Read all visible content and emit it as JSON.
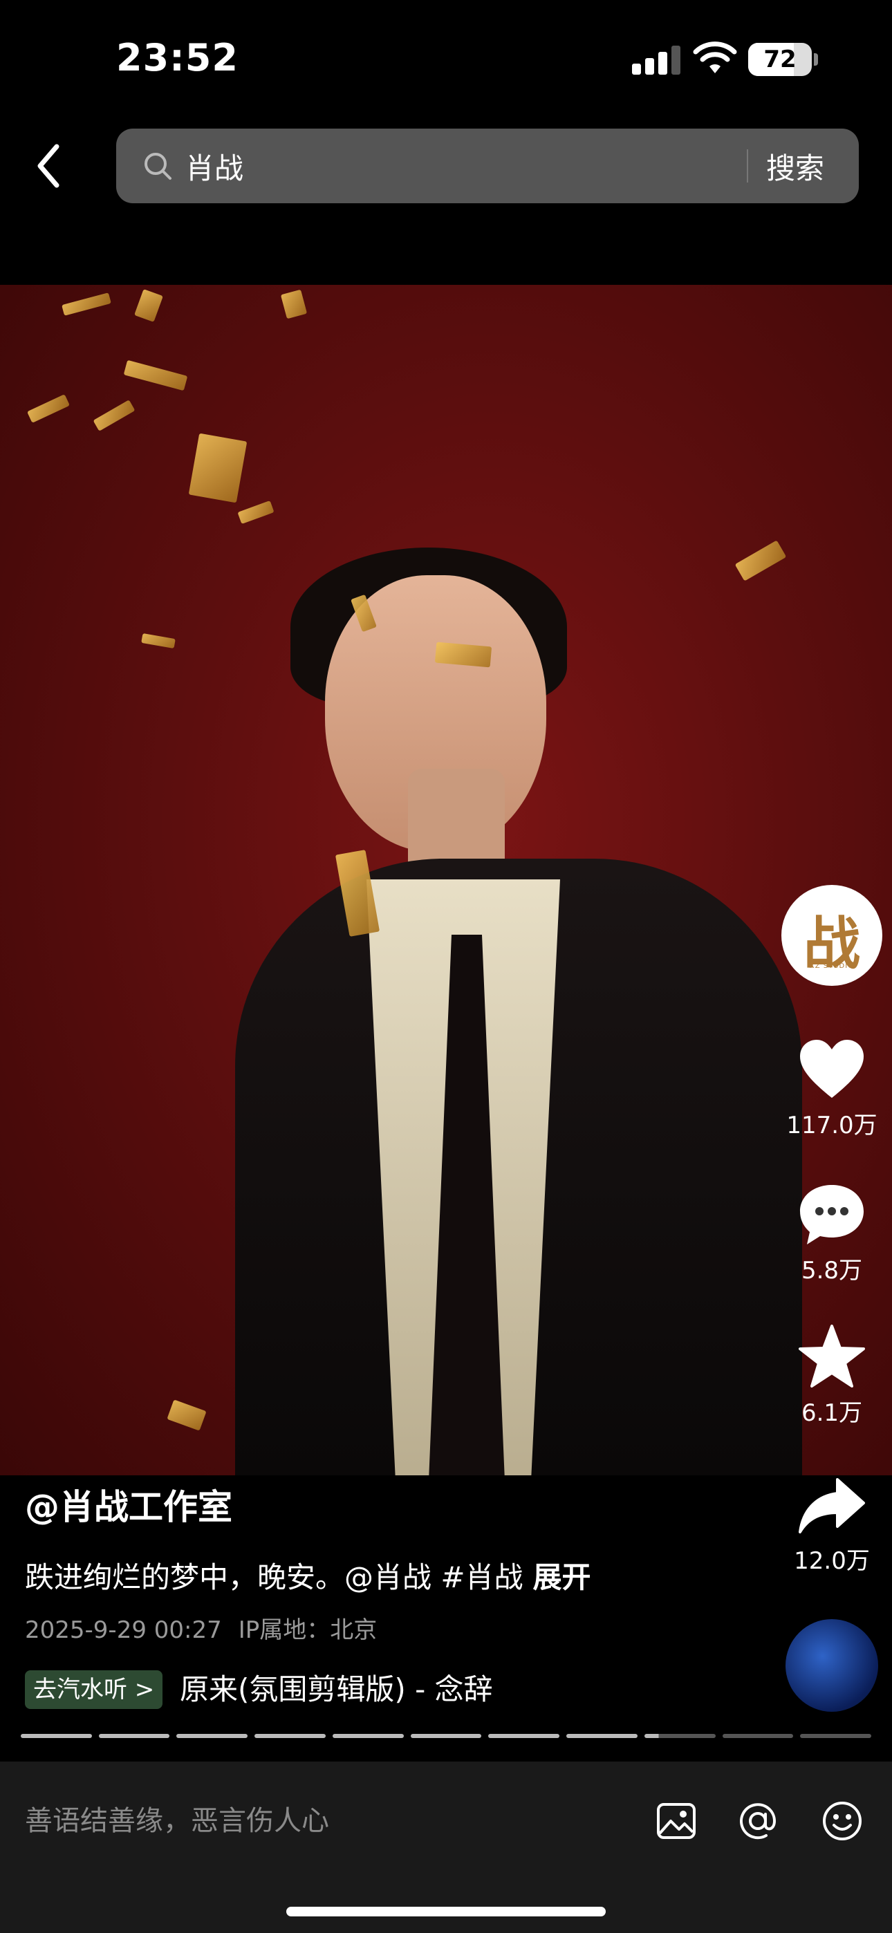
{
  "status_bar": {
    "time": "23:52",
    "battery": "72",
    "battery_level_percent": 72
  },
  "search": {
    "query": "肖战",
    "button_label": "搜索"
  },
  "icons": {
    "back": "chevron-left-icon",
    "search": "magnifier-icon",
    "like": "heart-icon",
    "comment": "comment-bubble-icon",
    "favorite": "star-icon",
    "share": "share-arrow-icon",
    "image": "image-icon",
    "mention": "at-icon",
    "emoji": "emoji-icon"
  },
  "author": {
    "avatar_text": "战",
    "avatar_subtext": "XZ STUDIO",
    "name": "@肖战工作室"
  },
  "actions": {
    "likes": "117.0万",
    "comments": "5.8万",
    "favorites": "6.1万",
    "shares": "12.0万"
  },
  "post": {
    "caption": "跌进绚烂的梦中，晚安。@肖战 #肖战",
    "expand_label": "展开",
    "date": "2025-9-29 00:27",
    "ip_location": "IP属地：北京"
  },
  "music": {
    "badge": "去汽水听 >",
    "title": "原来(氛围剪辑版) - 念辞"
  },
  "playlist_progress": {
    "total_segments": 11,
    "current_index": 8,
    "current_fraction": 0.2
  },
  "comment_bar": {
    "placeholder": "善语结善缘，恶言伤人心"
  },
  "colors": {
    "video_background": "#5c0e0e",
    "music_badge": "#2d4a32",
    "avatar_glyph": "#b07a35"
  }
}
